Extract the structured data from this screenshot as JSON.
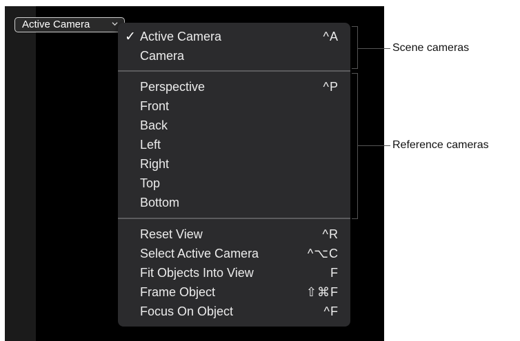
{
  "popup": {
    "label": "Active Camera",
    "chevron_icon": "chevron-down-icon"
  },
  "menu": {
    "scene_cameras": [
      {
        "label": "Active Camera",
        "shortcut": "^A",
        "checked": true
      },
      {
        "label": "Camera",
        "shortcut": "",
        "checked": false
      }
    ],
    "reference_cameras": [
      {
        "label": "Perspective",
        "shortcut": "^P"
      },
      {
        "label": "Front",
        "shortcut": ""
      },
      {
        "label": "Back",
        "shortcut": ""
      },
      {
        "label": "Left",
        "shortcut": ""
      },
      {
        "label": "Right",
        "shortcut": ""
      },
      {
        "label": "Top",
        "shortcut": ""
      },
      {
        "label": "Bottom",
        "shortcut": ""
      }
    ],
    "view_commands": [
      {
        "label": "Reset View",
        "shortcut": "^R"
      },
      {
        "label": "Select Active Camera",
        "shortcut": "^⌥C"
      },
      {
        "label": "Fit Objects Into View",
        "shortcut": "F"
      },
      {
        "label": "Frame Object",
        "shortcut": "⇧⌘F"
      },
      {
        "label": "Focus On Object",
        "shortcut": "^F"
      }
    ],
    "check_mark": "✓"
  },
  "callouts": {
    "scene_cameras": "Scene cameras",
    "reference_cameras": "Reference cameras"
  },
  "colors": {
    "menu_background": "#2b2b2d",
    "viewer_background": "#000000",
    "menu_text": "#ececec"
  }
}
